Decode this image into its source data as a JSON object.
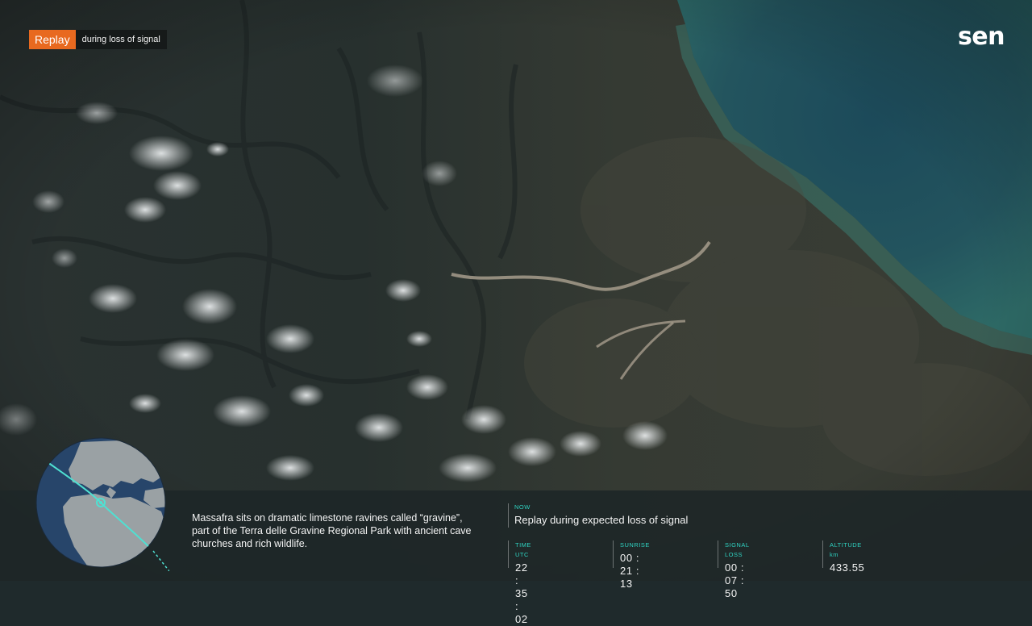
{
  "badge": {
    "label": "Replay",
    "subtitle": "during loss of signal"
  },
  "brand": {
    "logo_text": "sen"
  },
  "colors": {
    "accent_orange": "#e8691f",
    "accent_teal": "#2fd3c2",
    "panel_bg": "#1e2728"
  },
  "caption": {
    "text": "Massafra sits on dramatic limestone ravines called “gravine”, part of the Terra delle Gravine Regional Park with ancient cave churches and rich wildlife."
  },
  "now": {
    "label": "NOW",
    "text": "Replay during expected loss of signal"
  },
  "stats": [
    {
      "label": "TIME UTC",
      "value": "22 : 35 : 02"
    },
    {
      "label": "SUNRISE",
      "value": "00 : 21 : 13"
    },
    {
      "label": "SIGNAL LOSS",
      "value": "00 : 07 : 50"
    },
    {
      "label": "ALTITUDE km",
      "value": "433.55"
    }
  ],
  "globe": {
    "icon": "globe-orbit-icon"
  }
}
